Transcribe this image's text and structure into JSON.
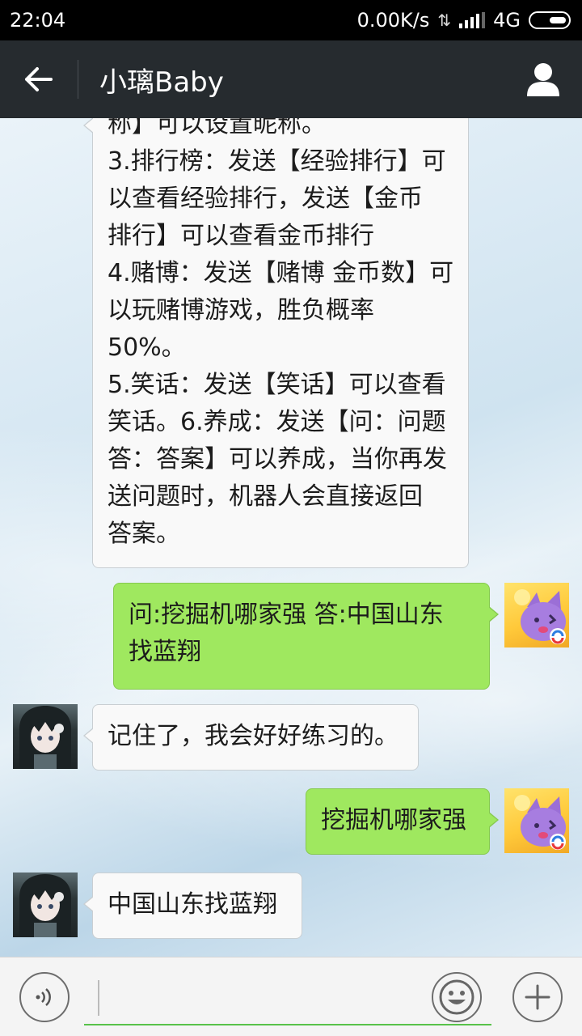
{
  "status_bar": {
    "time": "22:04",
    "speed": "0.00K/s",
    "network": "4G"
  },
  "header": {
    "back_icon": "arrow-left-icon",
    "title": "小璃Baby",
    "profile_icon": "person-icon"
  },
  "messages": [
    {
      "sender": "bot",
      "lines": [
        "称】可以设置昵称。",
        "3.排行榜：发送【经验排行】可",
        "以查看经验排行，发送【金币",
        "排行】可以查看金币排行",
        "4.赌博：发送【赌博 金币数】可",
        "以玩赌博游戏，胜负概率",
        "50%。",
        "5.笑话：发送【笑话】可以查看",
        "笑话。6.养成：发送【问：问题",
        "答：答案】可以养成，当你再发",
        "送问题时，机器人会直接返回",
        "答案。"
      ]
    },
    {
      "sender": "user",
      "lines": [
        "问:挖掘机哪家强 答:中国山东",
        "找蓝翔"
      ]
    },
    {
      "sender": "bot",
      "lines": [
        "记住了，我会好好练习的。"
      ]
    },
    {
      "sender": "user",
      "lines": [
        "挖掘机哪家强"
      ]
    },
    {
      "sender": "bot",
      "lines": [
        "中国山东找蓝翔"
      ]
    }
  ],
  "input_bar": {
    "voice_icon": "voice-icon",
    "input_value": "",
    "emoji_icon": "smiley-icon",
    "more_icon": "plus-icon"
  },
  "colors": {
    "titlebar": "#262b2f",
    "user_bubble": "#9fe85f",
    "bot_bubble": "#f9f9f9",
    "input_underline": "#58c24a"
  }
}
